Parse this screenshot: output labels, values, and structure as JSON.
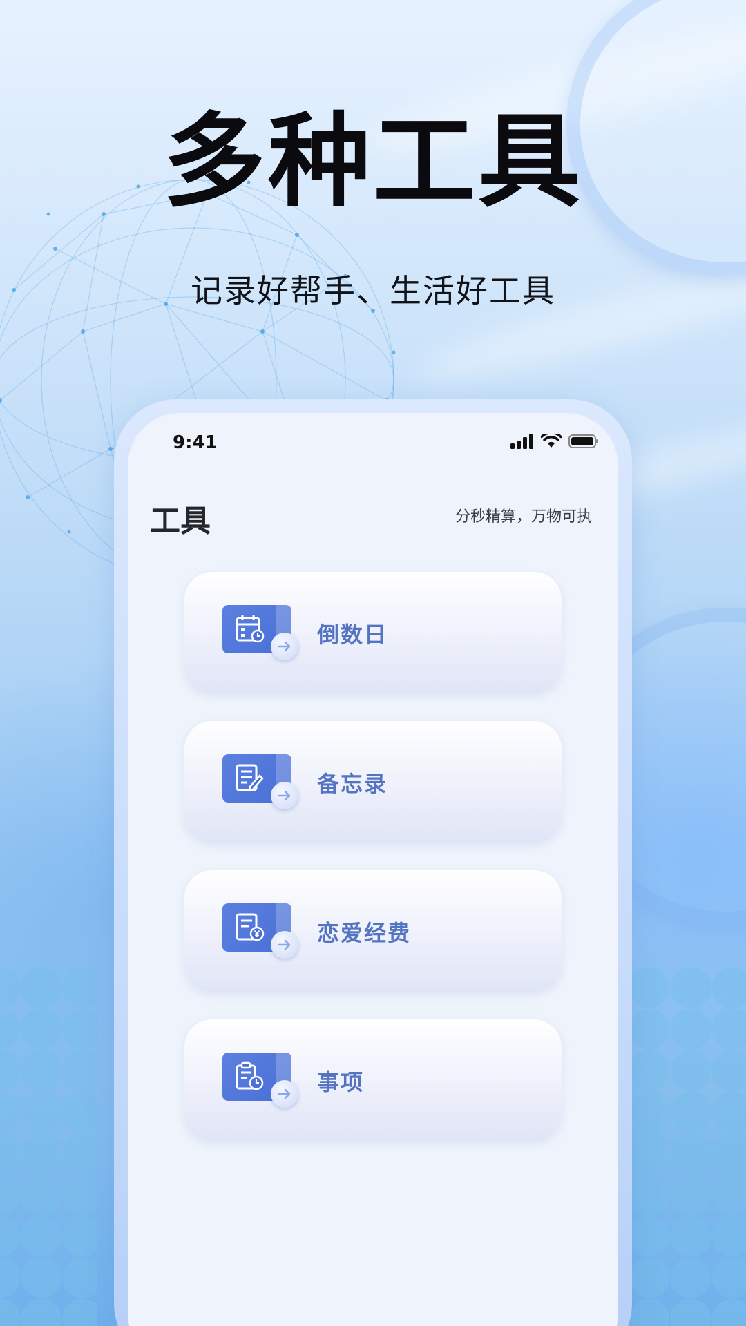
{
  "hero": {
    "title": "多种工具",
    "subtitle": "记录好帮手、生活好工具"
  },
  "status_bar": {
    "time": "9:41",
    "icons": [
      "signal-icon",
      "wifi-icon",
      "battery-icon"
    ]
  },
  "page": {
    "title": "工具",
    "slogan": "分秒精算，万物可执"
  },
  "tools": [
    {
      "label": "倒数日",
      "icon": "calendar-countdown-icon"
    },
    {
      "label": "备忘录",
      "icon": "memo-edit-icon"
    },
    {
      "label": "恋爱经费",
      "icon": "expense-yuan-icon"
    },
    {
      "label": "事项",
      "icon": "clipboard-clock-icon"
    }
  ],
  "colors": {
    "accent": "#5474c2",
    "icon_tile": "#4a6fd6",
    "background_top": "#e7f2ff",
    "background_bottom": "#6fb0ec"
  }
}
